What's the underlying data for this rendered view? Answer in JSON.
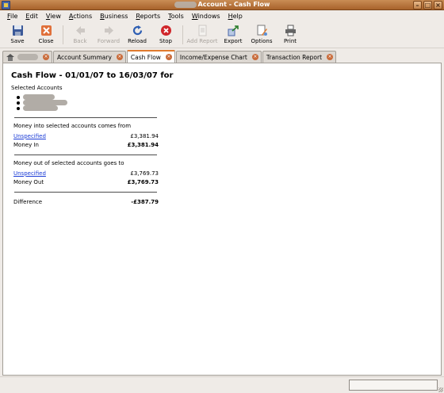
{
  "window": {
    "title": "Account - Cash Flow"
  },
  "menu": [
    {
      "label": "File",
      "u": "F",
      "rest": "ile"
    },
    {
      "label": "Edit",
      "u": "E",
      "rest": "dit"
    },
    {
      "label": "View",
      "u": "V",
      "rest": "iew"
    },
    {
      "label": "Actions",
      "u": "A",
      "rest": "ctions"
    },
    {
      "label": "Business",
      "u": "B",
      "rest": "usiness"
    },
    {
      "label": "Reports",
      "u": "R",
      "rest": "eports"
    },
    {
      "label": "Tools",
      "u": "T",
      "rest": "ools"
    },
    {
      "label": "Windows",
      "u": "W",
      "rest": "indows"
    },
    {
      "label": "Help",
      "u": "H",
      "rest": "elp"
    }
  ],
  "toolbar": {
    "save": "Save",
    "close": "Close",
    "back": "Back",
    "forward": "Forward",
    "reload": "Reload",
    "stop": "Stop",
    "add_report": "Add Report",
    "export": "Export",
    "options": "Options",
    "print": "Print"
  },
  "tabs": {
    "account_summary": "Account Summary",
    "cash_flow": "Cash Flow",
    "income_expense_chart": "Income/Expense Chart",
    "transaction_report": "Transaction Report"
  },
  "report": {
    "title": "Cash Flow - 01/01/07 to 16/03/07 for",
    "selected_accounts": "Selected Accounts",
    "money_in_heading": "Money into selected accounts comes from",
    "in_source": "Unspecified",
    "in_source_amount": "£3,381.94",
    "money_in_label": "Money In",
    "money_in_total": "£3,381.94",
    "money_out_heading": "Money out of selected accounts goes to",
    "out_source": "Unspecified",
    "out_source_amount": "£3,769.73",
    "money_out_label": "Money Out",
    "money_out_total": "£3,769.73",
    "difference_label": "Difference",
    "difference_value": "-£387.79"
  },
  "statusbar": {
    "progress": 0
  }
}
